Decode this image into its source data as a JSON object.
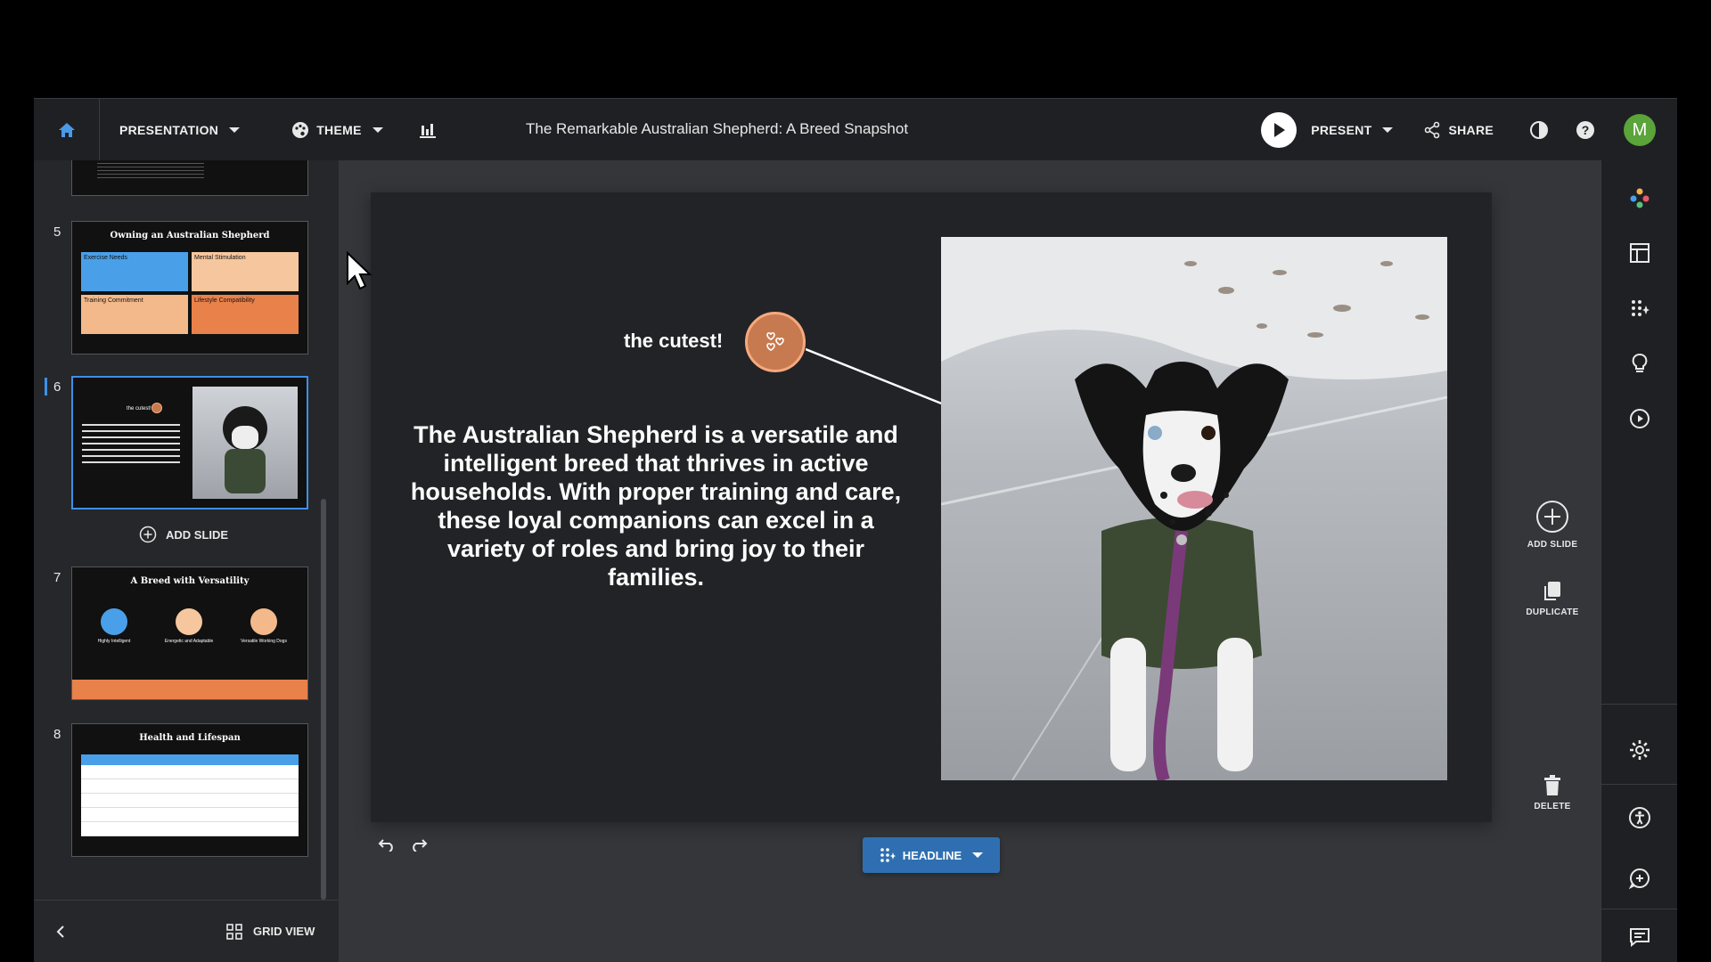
{
  "topbar": {
    "presentation_label": "PRESENTATION",
    "theme_label": "THEME",
    "doc_title": "The Remarkable Australian Shepherd: A Breed Snapshot",
    "present_label": "PRESENT",
    "share_label": "SHARE",
    "avatar_initial": "M"
  },
  "sidebar": {
    "slides": [
      {
        "number": "5",
        "title": "Owning an Australian Shepherd",
        "cards": [
          "Exercise Needs",
          "Mental Stimulation",
          "Training Commitment",
          "Lifestyle Compatibility"
        ]
      },
      {
        "number": "6",
        "title": "",
        "caption": "the cutest!"
      },
      {
        "number": "7",
        "title": "A Breed with Versatility",
        "items": [
          "Highly Intelligent",
          "Energetic and Adaptable",
          "Versatile Working Dogs"
        ]
      },
      {
        "number": "8",
        "title": "Health and Lifespan"
      }
    ],
    "add_slide_label": "ADD SLIDE",
    "grid_view_label": "GRID VIEW"
  },
  "slide": {
    "annotation": "the cutest!",
    "headline": "The Australian Shepherd is a versatile and intelligent breed that thrives in active households. With proper training and care, these loyal companions can excel in a variety of roles and bring joy to their families."
  },
  "actions": {
    "add_slide": "ADD SLIDE",
    "duplicate": "DUPLICATE",
    "delete": "DELETE"
  },
  "bottom": {
    "headline_btn": "HEADLINE"
  },
  "colors": {
    "accent": "#3f8fe6",
    "badge": "#c77a4f",
    "avatar": "#5aa43a"
  }
}
